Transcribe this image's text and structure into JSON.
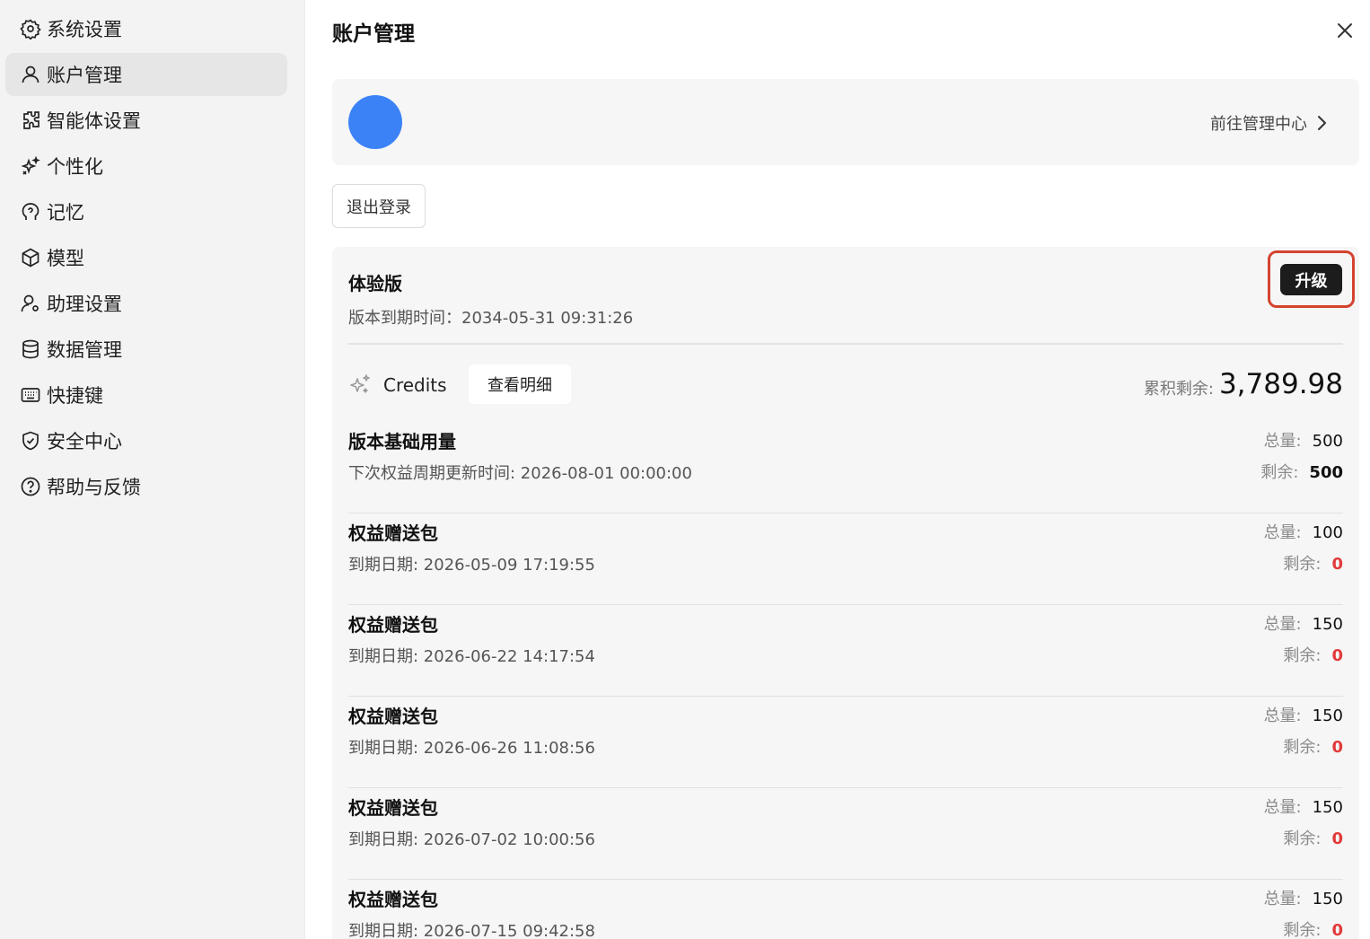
{
  "sidebar": {
    "items": [
      {
        "label": "系统设置",
        "icon": "gear-icon"
      },
      {
        "label": "账户管理",
        "icon": "user-icon",
        "active": true
      },
      {
        "label": "智能体设置",
        "icon": "puzzle-icon"
      },
      {
        "label": "个性化",
        "icon": "sparkle-icon"
      },
      {
        "label": "记忆",
        "icon": "brain-icon"
      },
      {
        "label": "模型",
        "icon": "cube-icon"
      },
      {
        "label": "助理设置",
        "icon": "user-gear-icon"
      },
      {
        "label": "数据管理",
        "icon": "database-icon"
      },
      {
        "label": "快捷键",
        "icon": "keyboard-icon"
      },
      {
        "label": "安全中心",
        "icon": "shield-icon"
      },
      {
        "label": "帮助与反馈",
        "icon": "help-circle-icon"
      }
    ]
  },
  "header": {
    "title": "账户管理"
  },
  "profile": {
    "admin_link": "前往管理中心",
    "avatar_color": "#3b82f6"
  },
  "logout_label": "退出登录",
  "plan": {
    "name": "体验版",
    "expire": "版本到期时间：2034-05-31 09:31:26",
    "upgrade_label": "升级"
  },
  "credits": {
    "label": "Credits",
    "detail_label": "查看明细",
    "balance_label": "累积剩余:",
    "balance_value": "3,789.98"
  },
  "labels": {
    "total": "总量:",
    "remaining": "剩余:"
  },
  "packages": [
    {
      "title": "版本基础用量",
      "sub": "下次权益周期更新时间: 2026-08-01 00:00:00",
      "total": "500",
      "remaining": "500",
      "remaining_color": "#111111"
    },
    {
      "title": "权益赠送包",
      "sub": "到期日期: 2026-05-09 17:19:55",
      "total": "100",
      "remaining": "0",
      "remaining_color": "#e23b3b"
    },
    {
      "title": "权益赠送包",
      "sub": "到期日期: 2026-06-22 14:17:54",
      "total": "150",
      "remaining": "0",
      "remaining_color": "#e23b3b"
    },
    {
      "title": "权益赠送包",
      "sub": "到期日期: 2026-06-26 11:08:56",
      "total": "150",
      "remaining": "0",
      "remaining_color": "#e23b3b"
    },
    {
      "title": "权益赠送包",
      "sub": "到期日期: 2026-07-02 10:00:56",
      "total": "150",
      "remaining": "0",
      "remaining_color": "#e23b3b"
    },
    {
      "title": "权益赠送包",
      "sub": "到期日期: 2026-07-15 09:42:58",
      "total": "150",
      "remaining": "0",
      "remaining_color": "#e23b3b"
    }
  ],
  "colors": {
    "accent_outline": "#d4432f",
    "upgrade_bg": "#1c1c1c"
  }
}
